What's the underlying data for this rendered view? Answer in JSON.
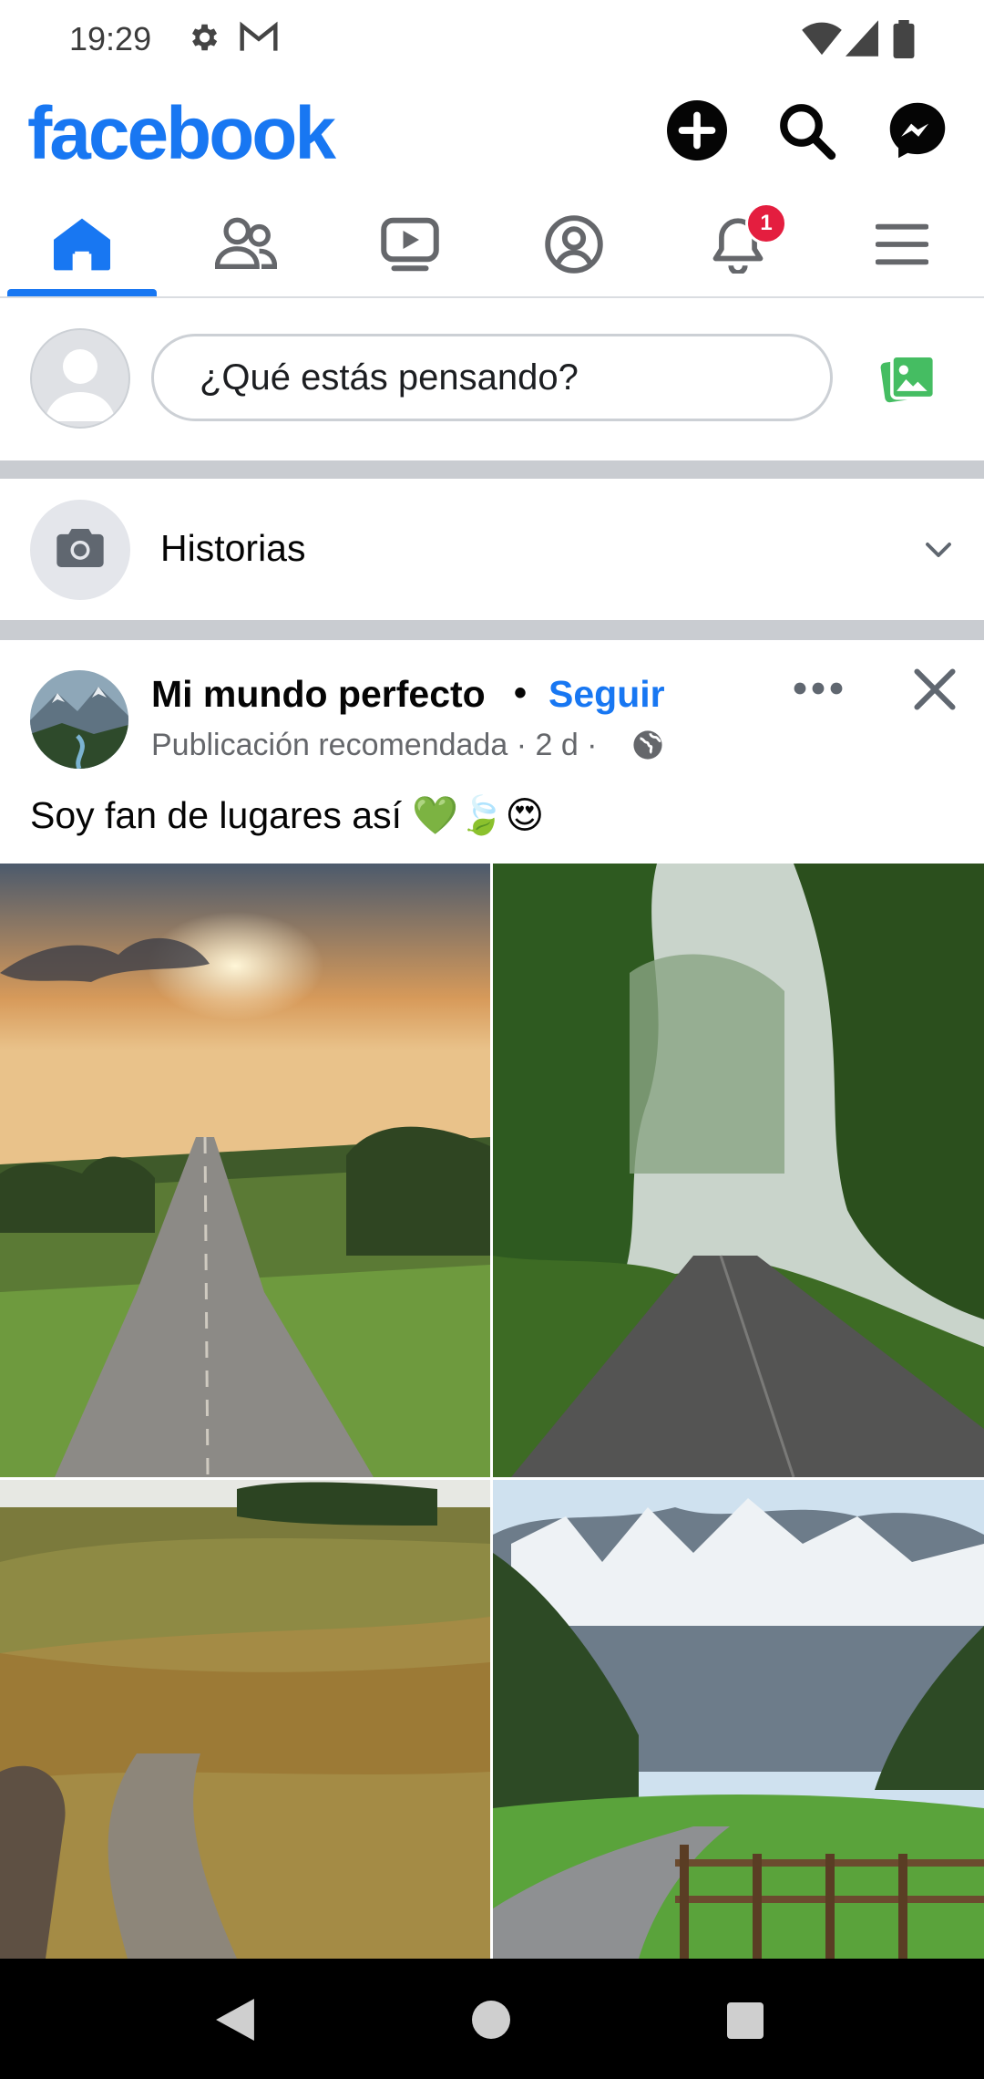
{
  "status_bar": {
    "time": "19:29",
    "left_icons": [
      "gear-icon",
      "gmail-icon"
    ],
    "right_icons": [
      "wifi-icon",
      "signal-icon",
      "battery-icon"
    ]
  },
  "header": {
    "logo": "facebook",
    "actions": [
      "plus-circle-icon",
      "search-icon",
      "messenger-icon"
    ],
    "brand_color": "#1877f2"
  },
  "tabs": [
    {
      "name": "home",
      "icon": "home-icon",
      "active": true
    },
    {
      "name": "friends",
      "icon": "friends-icon",
      "active": false
    },
    {
      "name": "watch",
      "icon": "video-icon",
      "active": false
    },
    {
      "name": "profile",
      "icon": "profile-icon",
      "active": false
    },
    {
      "name": "notifications",
      "icon": "bell-icon",
      "active": false,
      "badge": "1"
    },
    {
      "name": "menu",
      "icon": "hamburger-icon",
      "active": false
    }
  ],
  "composer": {
    "placeholder": "¿Qué estás pensando?",
    "photo_icon": "photo-icon"
  },
  "stories": {
    "label": "Historias",
    "icon": "camera-icon"
  },
  "post": {
    "author": "Mi mundo perfecto",
    "separator": "•",
    "follow_label": "Seguir",
    "meta": "Publicación recomendada · 2 d ·",
    "text": "Soy fan de lugares así 💚🍃😍",
    "images": [
      "sunset country road",
      "forest road",
      "valley road",
      "mountain road with fence"
    ]
  },
  "navbar": {
    "buttons": [
      "back-button",
      "home-button",
      "recents-button"
    ]
  }
}
